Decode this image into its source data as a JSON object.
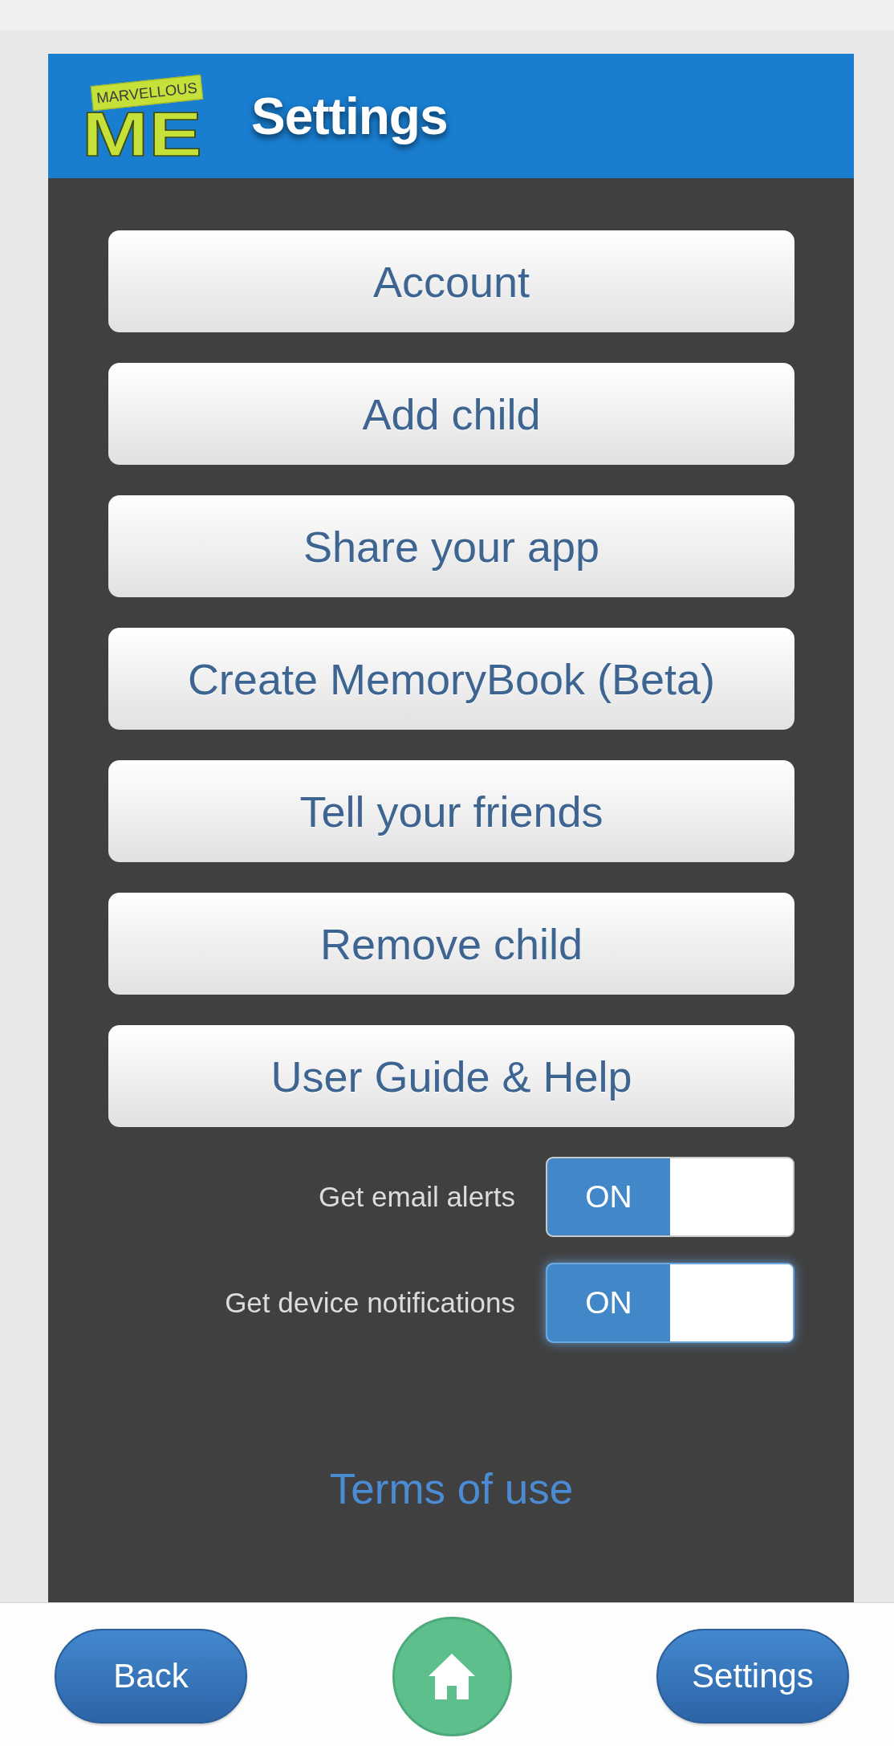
{
  "header": {
    "logo": {
      "banner_text": "MARVELLOUS",
      "letters": "ME"
    },
    "title": "Settings"
  },
  "menu_buttons": [
    {
      "label": "Account"
    },
    {
      "label": "Add child"
    },
    {
      "label": "Share your app"
    },
    {
      "label": "Create MemoryBook (Beta)"
    },
    {
      "label": "Tell your friends"
    },
    {
      "label": "Remove child"
    },
    {
      "label": "User Guide & Help"
    }
  ],
  "toggles": [
    {
      "label": "Get email alerts",
      "state_text": "ON",
      "on": true,
      "focused": false
    },
    {
      "label": "Get device notifications",
      "state_text": "ON",
      "on": true,
      "focused": true
    }
  ],
  "terms_link": "Terms of use",
  "bottom_bar": {
    "buttons": [
      {
        "kind": "pill",
        "label": "Back"
      },
      {
        "kind": "home"
      },
      {
        "kind": "pill",
        "label": "Settings"
      }
    ]
  }
}
